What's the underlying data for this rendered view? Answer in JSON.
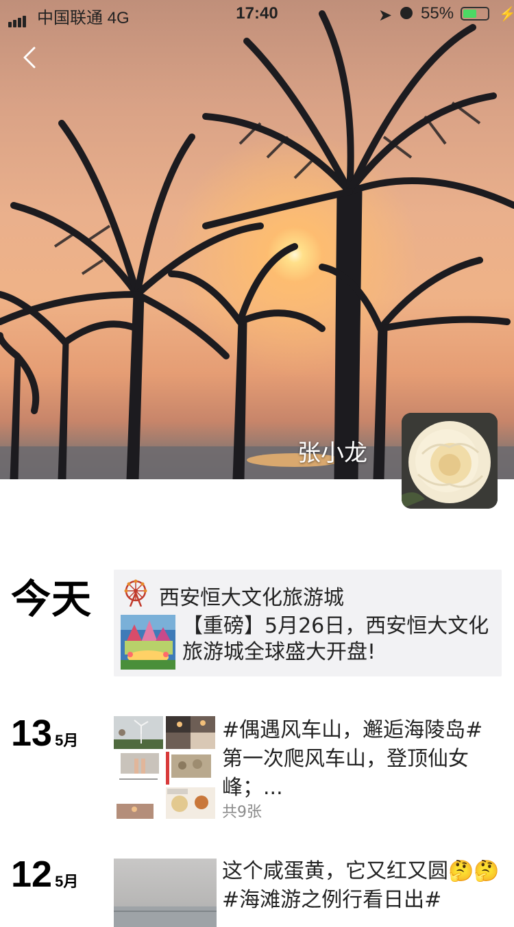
{
  "status_bar": {
    "carrier": "中国联通",
    "network": "4G",
    "time": "17:40",
    "battery_percent": "55%",
    "battery_level": 0.55
  },
  "profile": {
    "user_name": "张小龙"
  },
  "timeline": {
    "today": {
      "day_label": "今天",
      "share": {
        "source_name": "西安恒大文化旅游城",
        "text": "【重磅】5月26日，西安恒大文化旅游城全球盛大开盘!"
      }
    },
    "entry_13": {
      "day": "13",
      "month": "5月",
      "text": "#偶遇风车山，邂逅海陵岛#第一次爬风车山，登顶仙女峰；...",
      "photo_count": "共9张"
    },
    "entry_12": {
      "day": "12",
      "month": "5月",
      "text": "这个咸蛋黄，它又红又圆🤔🤔#海滩游之例行看日出#"
    }
  },
  "colors": {
    "battery_fill": "#4cd964",
    "card_bg": "#f2f2f4",
    "muted_text": "#8a8a8a"
  }
}
